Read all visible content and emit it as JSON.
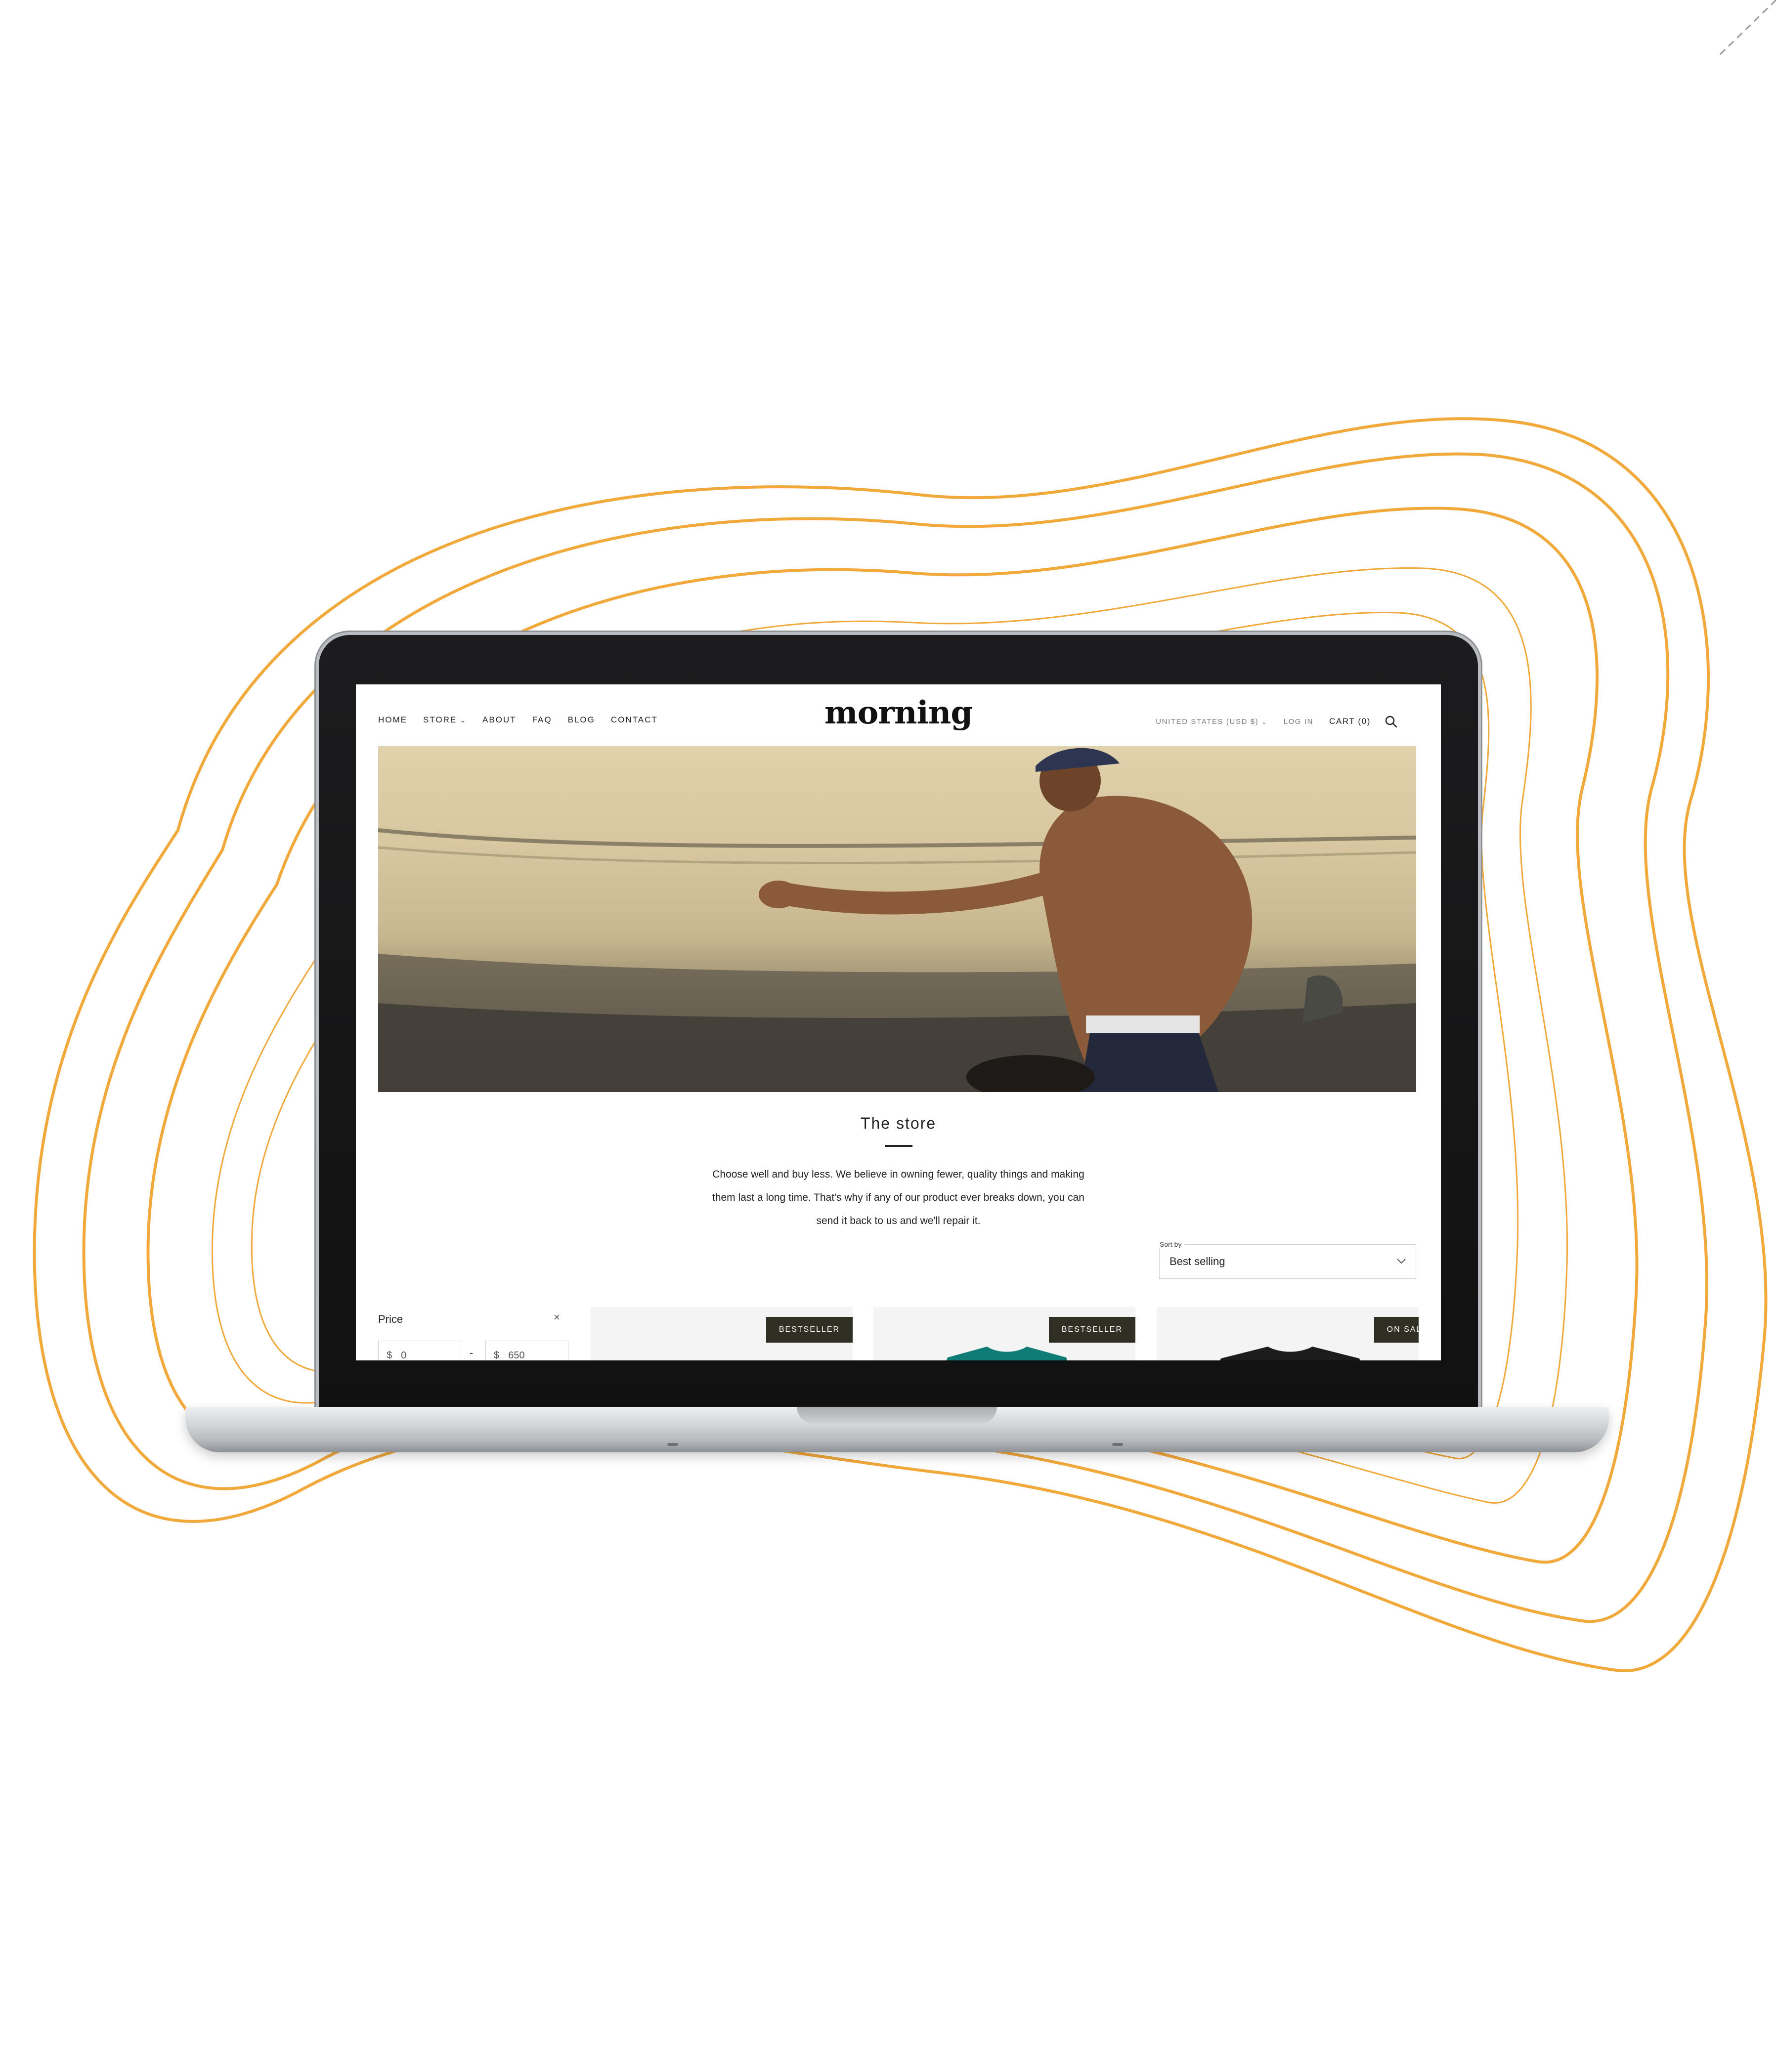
{
  "store": {
    "nav": [
      {
        "label": "HOME",
        "dropdown": false
      },
      {
        "label": "STORE",
        "dropdown": true
      },
      {
        "label": "ABOUT",
        "dropdown": false
      },
      {
        "label": "FAQ",
        "dropdown": false
      },
      {
        "label": "BLOG",
        "dropdown": false
      },
      {
        "label": "CONTACT",
        "dropdown": false
      }
    ],
    "brand": "morning",
    "header_right": {
      "currency": "UNITED STATES (USD $)",
      "login": "LOG IN",
      "cart": "CART (0)"
    },
    "title": "The store",
    "intro_lines": [
      "Choose well and buy less. We believe in owning fewer, quality things and making",
      "them last a long time. That's why if any of our product ever breaks down, you can",
      "send it back to us and we'll repair it."
    ],
    "sort": {
      "label": "Sort by",
      "value": "Best selling"
    },
    "filter": {
      "title": "Price",
      "clear": "×",
      "currency_symbol": "$",
      "min": "0",
      "max": "650",
      "separator": "-"
    },
    "products": [
      {
        "badge": "BESTSELLER",
        "shirt_color": null
      },
      {
        "badge": "BESTSELLER",
        "shirt_color": "#0f7d76"
      },
      {
        "badge": "ON SALE",
        "shirt_color": "#1c1c1c"
      }
    ]
  },
  "colors": {
    "accent_lines": "#f2a93b",
    "badge_bg": "#2f2f24"
  }
}
